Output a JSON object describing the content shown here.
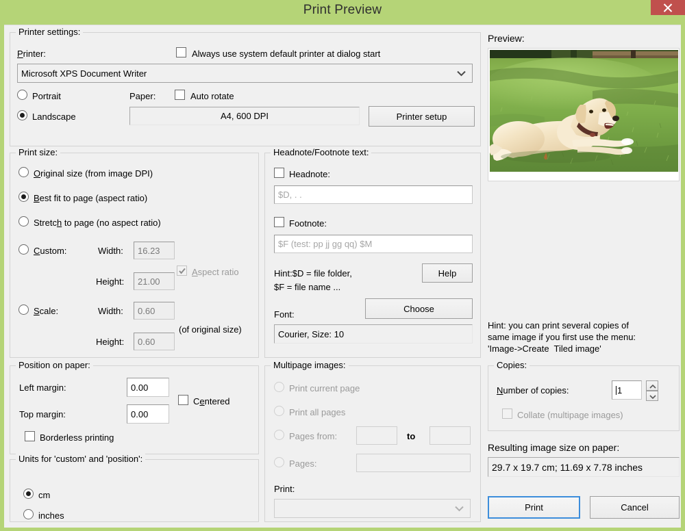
{
  "window": {
    "title": "Print Preview",
    "close_label": "×",
    "accent_title_bg": "#b5d477",
    "accent_close_bg": "#c0504d",
    "dialog_bg": "#f0f0f0"
  },
  "printer_settings": {
    "group_title": "Printer settings:",
    "printer_label": "Printer:",
    "always_default_checkbox": {
      "label": "Always use system default printer at dialog start",
      "checked": false
    },
    "printer_combo": {
      "value": "Microsoft XPS Document Writer"
    },
    "orientation": {
      "portrait": {
        "label": "Portrait",
        "selected": false
      },
      "landscape": {
        "label": "Landscape",
        "selected": true
      }
    },
    "paper_label": "Paper:",
    "auto_rotate_checkbox": {
      "label": "Auto rotate",
      "checked": false
    },
    "paper_value": "A4,      600 DPI",
    "printer_setup_button": "Printer setup"
  },
  "print_size": {
    "group_title": "Print size:",
    "options": [
      {
        "label": "Original size (from image DPI)",
        "selected": false
      },
      {
        "label": "Best fit to page (aspect ratio)",
        "selected": true
      },
      {
        "label": "Stretch to page (no aspect ratio)",
        "selected": false
      },
      {
        "label": "Custom:",
        "selected": false
      },
      {
        "label": "Scale:",
        "selected": false
      }
    ],
    "custom": {
      "width_label": "Width:",
      "width_value": "16.23",
      "height_label": "Height:",
      "height_value": "21.00"
    },
    "aspect_ratio_checkbox": {
      "label": "Aspect ratio",
      "checked": true,
      "enabled": false
    },
    "scale": {
      "width_label": "Width:",
      "width_value": "0.60",
      "height_label": "Height:",
      "height_value": "0.60",
      "note": "(of original size)"
    }
  },
  "headnote_footnote": {
    "group_title": "Headnote/Footnote text:",
    "headnote_checkbox": {
      "label": "Headnote:",
      "checked": false
    },
    "headnote_placeholder": "$D, . .",
    "footnote_checkbox": {
      "label": "Footnote:",
      "checked": false
    },
    "footnote_placeholder": "$F (test: pp jj gg qq) $M",
    "hint_line1": "Hint:$D = file folder,",
    "hint_line2": "$F = file name ...",
    "help_button": "Help",
    "font_label": "Font:",
    "choose_button": "Choose",
    "font_value": "Courier, Size: 10"
  },
  "position_on_paper": {
    "group_title": "Position on paper:",
    "left_margin_label": "Left margin:",
    "left_margin_value": "0.00",
    "top_margin_label": "Top margin:",
    "top_margin_value": "0.00",
    "centered_checkbox": {
      "label": "Centered",
      "checked": false
    },
    "borderless_checkbox": {
      "label": "Borderless printing",
      "checked": false
    }
  },
  "units": {
    "group_title": "Units for 'custom' and 'position':",
    "options": [
      {
        "label": "cm",
        "selected": true
      },
      {
        "label": "inches",
        "selected": false
      }
    ]
  },
  "multipage": {
    "group_title": "Multipage images:",
    "enabled": false,
    "options": [
      {
        "label": "Print current page",
        "selected": false
      },
      {
        "label": "Print all pages",
        "selected": false
      },
      {
        "label": "Pages from:",
        "selected": false
      },
      {
        "label": "Pages:",
        "selected": false
      }
    ],
    "pages_from_value": "",
    "pages_to_label": "to",
    "pages_to_value": "",
    "pages_list_value": "",
    "print_label": "Print:",
    "print_combo_value": ""
  },
  "preview": {
    "label": "Preview:",
    "image_alt": "yellow Labrador retriever lying on green grass"
  },
  "right_hint": {
    "line1": "Hint: you can print several copies of",
    "line2": "same image if you first use the menu:",
    "line3": "'Image->Create  Tiled image'"
  },
  "copies": {
    "group_title": "Copies:",
    "number_label": "Number of copies:",
    "number_value": "1",
    "collate_checkbox": {
      "label": "Collate (multipage images)",
      "checked": false,
      "enabled": false
    }
  },
  "result": {
    "label": "Resulting image size on paper:",
    "value": "29.7 x 19.7 cm; 11.69 x 7.78 inches"
  },
  "actions": {
    "print_button": "Print",
    "cancel_button": "Cancel"
  }
}
